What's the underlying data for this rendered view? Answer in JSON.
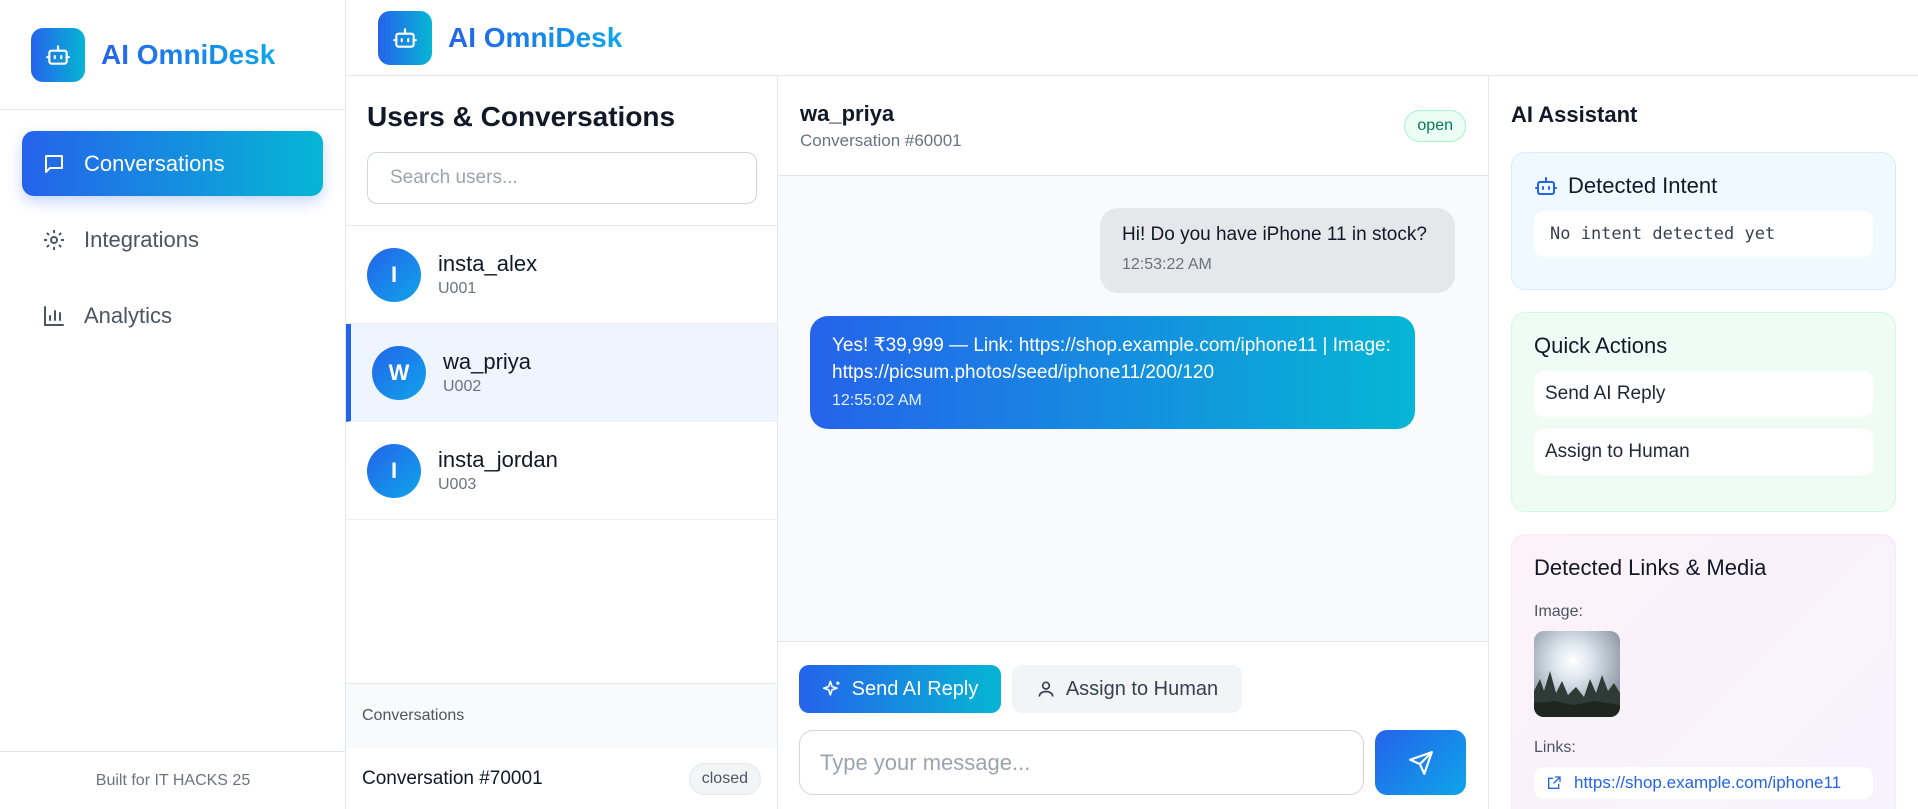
{
  "app": {
    "name": "AI OmniDesk",
    "logo_icon": "robot-icon"
  },
  "sidebar": {
    "items": [
      {
        "label": "Conversations",
        "icon": "chat-bubble-icon",
        "active": true
      },
      {
        "label": "Integrations",
        "icon": "gear-icon",
        "active": false
      },
      {
        "label": "Analytics",
        "icon": "bar-chart-icon",
        "active": false
      }
    ],
    "footer": "Built for IT HACKS 25"
  },
  "users_panel": {
    "title": "Users & Conversations",
    "search_placeholder": "Search users...",
    "users": [
      {
        "initial": "I",
        "name": "insta_alex",
        "id": "U001",
        "selected": false
      },
      {
        "initial": "W",
        "name": "wa_priya",
        "id": "U002",
        "selected": true
      },
      {
        "initial": "I",
        "name": "insta_jordan",
        "id": "U003",
        "selected": false
      }
    ],
    "conversations_header": "Conversations",
    "conversations": [
      {
        "title": "Conversation #70001",
        "status": "closed"
      }
    ]
  },
  "chat": {
    "user": "wa_priya",
    "subtitle": "Conversation #60001",
    "status": "open",
    "messages": [
      {
        "direction": "incoming",
        "text": "Hi! Do you have iPhone 11 in stock?",
        "time": "12:53:22 AM"
      },
      {
        "direction": "outgoing",
        "text": "Yes! ₹39,999 — Link: https://shop.example.com/iphone11 | Image: https://picsum.photos/seed/iphone11/200/120",
        "time": "12:55:02 AM"
      }
    ],
    "send_ai_label": "Send AI Reply",
    "assign_label": "Assign to Human",
    "input_placeholder": "Type your message..."
  },
  "assistant": {
    "title": "AI Assistant",
    "intent_title": "Detected Intent",
    "intent_value": "No intent detected yet",
    "actions_title": "Quick Actions",
    "actions": [
      "Send AI Reply",
      "Assign to Human"
    ],
    "links_title": "Detected Links & Media",
    "image_label": "Image:",
    "links_label": "Links:",
    "links": [
      "https://shop.example.com/iphone11"
    ]
  },
  "colors": {
    "accent": "#2563eb",
    "accent2": "#06b6d4",
    "open": "#047857"
  }
}
